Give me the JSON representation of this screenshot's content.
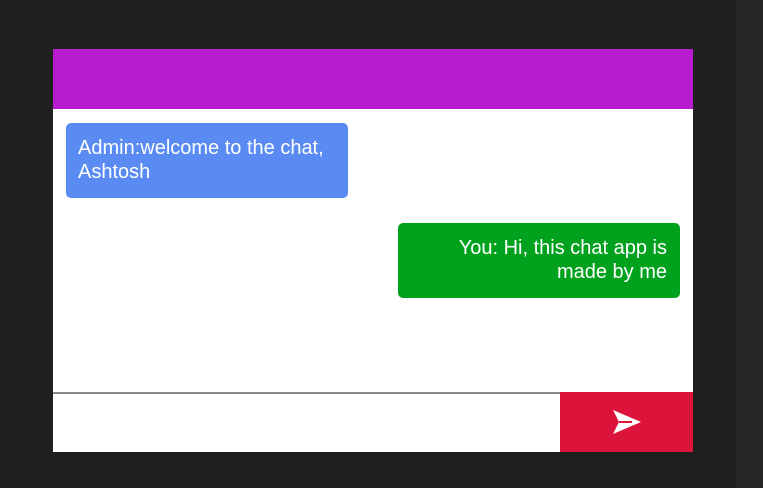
{
  "colors": {
    "header": "#b71ccf",
    "received_bubble": "#5a8bf2",
    "sent_bubble": "#00a11c",
    "send_button": "#dc143c"
  },
  "messages": [
    {
      "sender": "Admin",
      "text": "Admin:welcome to the chat, Ashtosh",
      "type": "received"
    },
    {
      "sender": "You",
      "text": "You: Hi, this chat app is made by me",
      "type": "sent"
    }
  ],
  "composer": {
    "input_value": "",
    "send_icon": "send-icon"
  }
}
